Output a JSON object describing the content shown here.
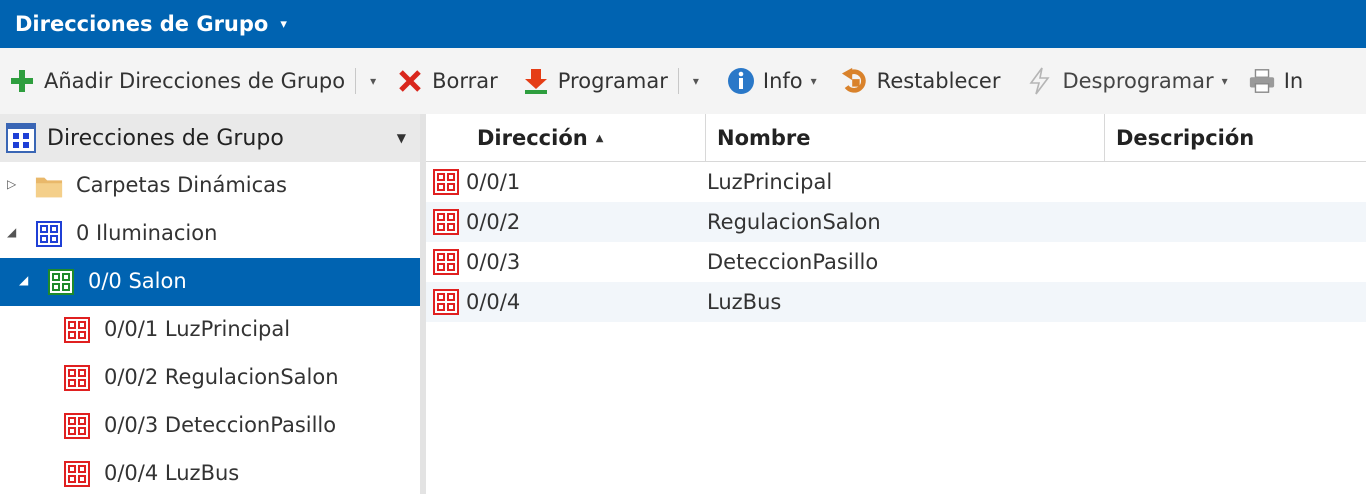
{
  "title_bar": {
    "title": "Direcciones de Grupo",
    "caret": "▾"
  },
  "toolbar": {
    "add_label": "Añadir Direcciones de Grupo",
    "delete_label": "Borrar",
    "program_label": "Programar",
    "info_label": "Info",
    "reset_label": "Restablecer",
    "unprogram_label": "Desprogramar",
    "print_label": "In",
    "drop_glyph": "▾"
  },
  "tree": {
    "header_title": "Direcciones de Grupo",
    "header_caret": "▼",
    "nodes": [
      {
        "label": "Carpetas Dinámicas",
        "arrow": "▷",
        "icon": "folder-icon"
      },
      {
        "label": "0 Iluminacion",
        "arrow": "◢",
        "icon": "main-group-icon"
      },
      {
        "label": "0/0 Salon",
        "arrow": "◢",
        "icon": "middle-group-icon",
        "selected": true
      },
      {
        "label": "0/0/1 LuzPrincipal",
        "icon": "group-address-icon"
      },
      {
        "label": "0/0/2 RegulacionSalon",
        "icon": "group-address-icon"
      },
      {
        "label": "0/0/3 DeteccionPasillo",
        "icon": "group-address-icon"
      },
      {
        "label": "0/0/4 LuzBus",
        "icon": "group-address-icon"
      }
    ]
  },
  "grid": {
    "columns": [
      "Dirección",
      "Nombre",
      "Descripción"
    ],
    "sort_glyph": "▲",
    "rows": [
      {
        "address": "0/0/1",
        "name": "LuzPrincipal",
        "description": ""
      },
      {
        "address": "0/0/2",
        "name": "RegulacionSalon",
        "description": ""
      },
      {
        "address": "0/0/3",
        "name": "DeteccionPasillo",
        "description": ""
      },
      {
        "address": "0/0/4",
        "name": "LuzBus",
        "description": ""
      }
    ]
  },
  "colors": {
    "accent": "#0063b1",
    "ga_red": "#e02020",
    "main_blue": "#1f3fd6",
    "middle_green": "#1f8a2a",
    "add_green": "#2e9e3e",
    "delete_red": "#d9261c",
    "info_blue": "#2a78c8",
    "reset_orange": "#d9822b"
  }
}
